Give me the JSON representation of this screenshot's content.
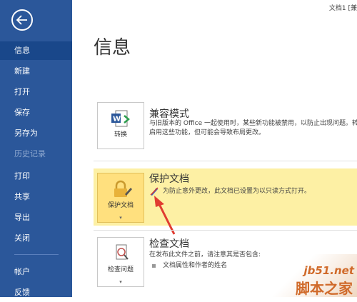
{
  "window": {
    "doc_title": "文档1 [兼"
  },
  "sidebar": {
    "items": [
      {
        "label": "信息"
      },
      {
        "label": "新建"
      },
      {
        "label": "打开"
      },
      {
        "label": "保存"
      },
      {
        "label": "另存为"
      },
      {
        "label": "历史记录"
      },
      {
        "label": "打印"
      },
      {
        "label": "共享"
      },
      {
        "label": "导出"
      },
      {
        "label": "关闭"
      },
      {
        "label": "帐户"
      },
      {
        "label": "反馈"
      }
    ]
  },
  "main": {
    "title": "信息",
    "compat": {
      "button_label": "转换",
      "title": "兼容模式",
      "text1": "与旧版本的 Office 一起使用时，某些新功能被禁用，以防止出现问题。转",
      "text2": "启用这些功能，但可能会导致布局更改。"
    },
    "protect": {
      "button_label": "保护文档",
      "title": "保护文档",
      "text": "为防止意外更改，此文档已设置为以只读方式打开。"
    },
    "inspect": {
      "button_label": "检查问题",
      "title": "检查文档",
      "text": "在发布此文件之前，请注意其是否包含:",
      "bullet": "文档属性和作者的姓名"
    }
  },
  "watermark": {
    "line1": "jb51.net",
    "line2": "脚本之家"
  },
  "colors": {
    "sidebar": "#2b579a",
    "sidebar_active": "#19478a",
    "protect_band": "#fdf0a4",
    "arrow": "#e03c31"
  }
}
